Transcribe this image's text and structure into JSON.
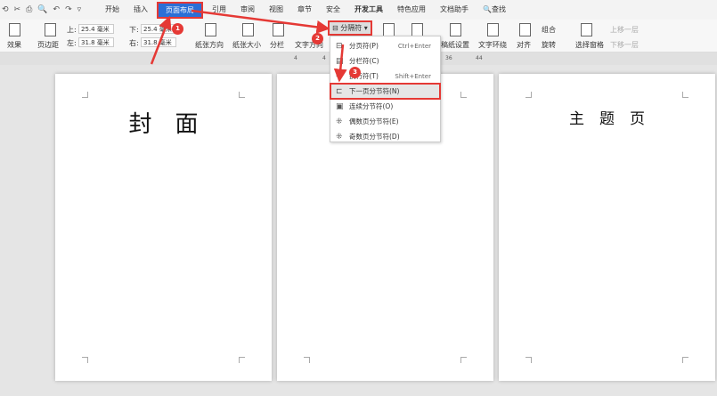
{
  "quick_access": [
    "⟲",
    "✂",
    "⎙",
    "🔍",
    "↶",
    "↷",
    "▿"
  ],
  "tabs": [
    "开始",
    "插入",
    "页面布局",
    "引用",
    "审阅",
    "视图",
    "章节",
    "安全",
    "开发工具",
    "特色应用",
    "文档助手",
    "查找"
  ],
  "ribbon": {
    "effect": "效果",
    "margin": "页边距",
    "top_label": "上:",
    "top_val": "25.4 毫米",
    "bottom_label": "下:",
    "bottom_val": "25.4 毫米",
    "left_label": "左:",
    "left_val": "31.8 毫米",
    "right_label": "右:",
    "right_val": "31.8 毫米",
    "orientation": "纸张方向",
    "size": "纸张大小",
    "columns": "分栏",
    "text_dir": "文字方向",
    "breaks": "分隔符",
    "grid": "稿纸设置",
    "wrap": "文字环绕",
    "align": "对齐",
    "group": "组合",
    "rotate": "旋转",
    "select_pane": "选择窗格",
    "bring_forward": "上移一层",
    "send_backward": "下移一层"
  },
  "ruler": [
    "4",
    "4",
    "36",
    "44"
  ],
  "menu": [
    {
      "label": "分页符(P)",
      "shortcut": "Ctrl+Enter",
      "icon": "page-break"
    },
    {
      "label": "分栏符(C)",
      "shortcut": "",
      "icon": "column-break"
    },
    {
      "label": "换行符(T)",
      "shortcut": "Shift+Enter",
      "icon": "line-break"
    },
    {
      "label": "下一页分节符(N)",
      "shortcut": "",
      "icon": "next-page-section"
    },
    {
      "label": "连续分节符(O)",
      "shortcut": "",
      "icon": "continuous-section"
    },
    {
      "label": "偶数页分节符(E)",
      "shortcut": "",
      "icon": "even-section"
    },
    {
      "label": "奇数页分节符(D)",
      "shortcut": "",
      "icon": "odd-section"
    }
  ],
  "pages": [
    {
      "title": "封　面"
    },
    {
      "title": "目　录　页"
    },
    {
      "title": "主　题　页"
    }
  ],
  "steps": [
    "1",
    "2",
    "3"
  ],
  "colors": {
    "accent": "#2b6fd6",
    "annotation": "#e53935"
  }
}
